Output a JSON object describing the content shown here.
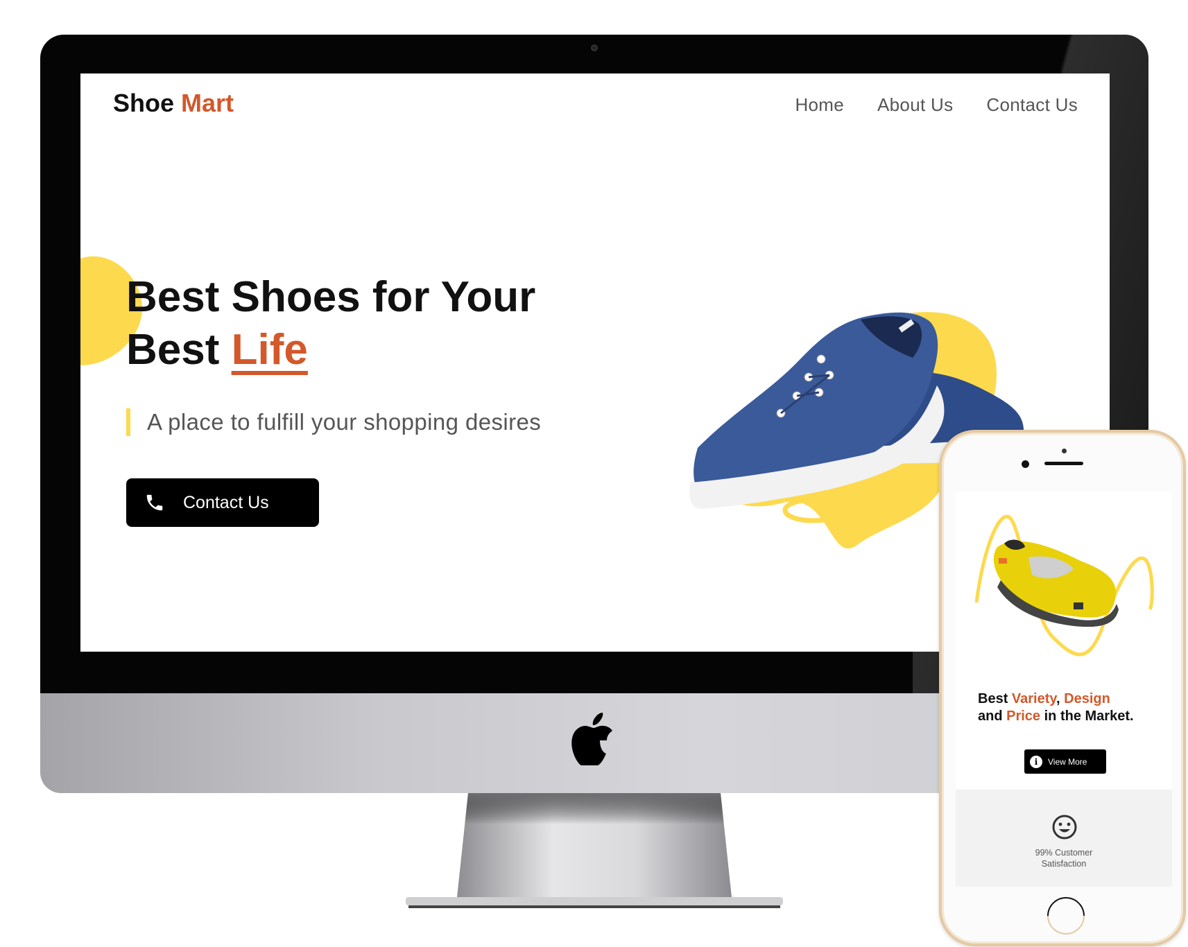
{
  "site": {
    "logo_main": "Shoe",
    "logo_accent": "Mart",
    "nav": [
      {
        "label": "Home"
      },
      {
        "label": "About Us"
      },
      {
        "label": "Contact Us"
      }
    ],
    "hero": {
      "title_line1": "Best Shoes for Your",
      "title_line2_prefix": "Best ",
      "title_line2_highlight": "Life",
      "tagline": "A place to fulfill your shopping desires",
      "cta_label": "Contact Us"
    }
  },
  "mobile": {
    "title": {
      "w1": "Best ",
      "w2": "Variety",
      "w3": ", ",
      "w4": "Design",
      "w5": "and ",
      "w6": "Price",
      "w7": " in the Market."
    },
    "view_more_label": "View More",
    "info_glyph": "i",
    "satisfaction_line1": "99% Customer",
    "satisfaction_line2": "Satisfaction"
  },
  "colors": {
    "accent": "#d3582a",
    "yellow": "#fdd94e",
    "shoe_blue": "#3a5a99",
    "button_bg": "#000000"
  },
  "icons": {
    "cta": "phone-icon",
    "view_more": "info-icon",
    "satisfaction": "smiley-icon",
    "device_brand": "apple-logo-icon"
  }
}
